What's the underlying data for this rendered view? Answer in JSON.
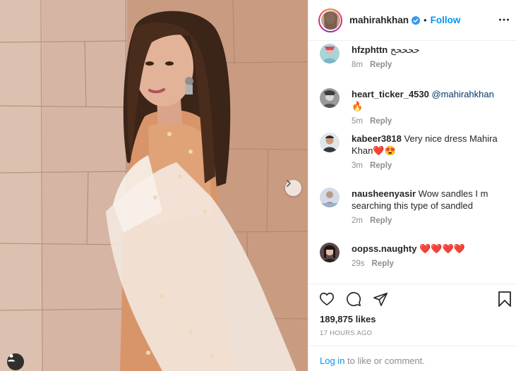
{
  "post": {
    "username": "mahirahkhan",
    "follow_label": "Follow",
    "separator": "•",
    "likes": "189,875 likes",
    "time_ago": "17 HOURS AGO",
    "login_link": "Log in",
    "login_suffix": " to like or comment."
  },
  "comments": [
    {
      "user": "hfzphttn",
      "text": " ححححح",
      "mention": "",
      "emoji": "",
      "time": "8m",
      "reply": "Reply"
    },
    {
      "user": "heart_ticker_4530",
      "text": " ",
      "mention": "@mahirahkhan",
      "emoji": "🔥",
      "time": "5m",
      "reply": "Reply"
    },
    {
      "user": "kabeer3818",
      "text": " Very nice dress Mahira Khan",
      "mention": "",
      "emoji": "❤️😍",
      "time": "3m",
      "reply": "Reply"
    },
    {
      "user": "nausheenyasir",
      "text": " Wow sandles I m searching this type of sandled",
      "mention": "",
      "emoji": "",
      "time": "2m",
      "reply": "Reply"
    },
    {
      "user": "oopss.naughty",
      "text": " ",
      "mention": "",
      "emoji": "❤️❤️❤️❤️",
      "time": "29s",
      "reply": "Reply"
    }
  ],
  "icons": {
    "header": [
      "avatar",
      "verified-badge-icon",
      "more-options-icon"
    ],
    "actions": [
      "heart-icon",
      "comment-icon",
      "share-icon",
      "bookmark-icon"
    ],
    "photo": [
      "chevron-right-icon",
      "user-tag-icon"
    ]
  },
  "colors": {
    "accent": "#0095f6",
    "text": "#262626",
    "muted": "#8e8e8e",
    "border": "#efefef"
  }
}
